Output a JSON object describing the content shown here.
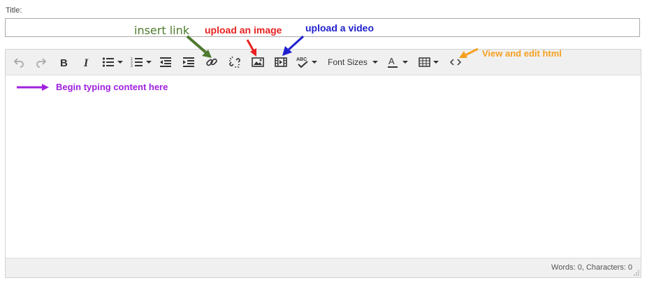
{
  "title_field": {
    "label": "Title:",
    "value": ""
  },
  "toolbar": {
    "font_sizes_label": "Font Sizes"
  },
  "status": {
    "counts": "Words: 0, Characters: 0"
  },
  "annotations": {
    "insert_link": "insert link",
    "upload_image": "upload an image",
    "upload_video": "upload a video",
    "view_html": "View and edit html",
    "begin_typing": "Begin typing content here"
  },
  "colors": {
    "insert_link": "#4d7a2e",
    "upload_image": "#e82020",
    "upload_video": "#2020d0",
    "view_html": "#f5a020",
    "begin_typing": "#a020e0"
  },
  "icons": [
    "undo-icon",
    "redo-icon",
    "bold-icon",
    "italic-icon",
    "bullet-list-icon",
    "numbered-list-icon",
    "outdent-icon",
    "indent-icon",
    "link-icon",
    "unlink-icon",
    "image-icon",
    "video-icon",
    "spellcheck-icon",
    "text-color-icon",
    "table-icon",
    "code-icon"
  ]
}
